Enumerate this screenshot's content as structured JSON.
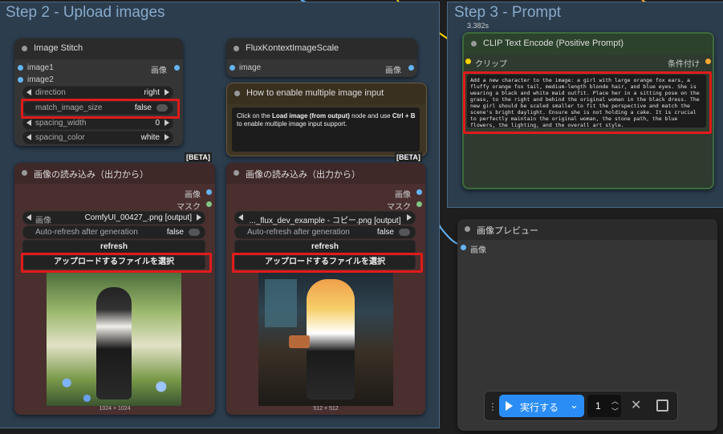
{
  "groups": {
    "step2": "Step 2 - Upload images",
    "step3": "Step 3 - Prompt"
  },
  "image_stitch": {
    "title": "Image Stitch",
    "inputs": [
      "image1",
      "image2"
    ],
    "output": "画像",
    "widgets": [
      {
        "label": "direction",
        "value": "right"
      },
      {
        "label": "match_image_size",
        "value": "false"
      },
      {
        "label": "spacing_width",
        "value": "0"
      },
      {
        "label": "spacing_color",
        "value": "white"
      }
    ]
  },
  "flux_scale": {
    "title": "FluxKontextImageScale",
    "input": "image",
    "output": "画像"
  },
  "how_to": {
    "title": "How to enable multiple image input",
    "text_pre": "Click on the ",
    "text_bold1": "Load image (from output)",
    "text_mid": " node and use ",
    "text_bold2": "Ctrl + B",
    "text_post": " to enable multiple image input support."
  },
  "beta_label": "[BETA]",
  "load_left": {
    "title": "画像の読み込み（出力から）",
    "output1": "画像",
    "output2": "マスク",
    "image_label": "画像",
    "image_value": "ComfyUI_00427_.png [output]",
    "auto_label": "Auto-refresh after generation",
    "auto_value": "false",
    "refresh": "refresh",
    "upload": "アップロードするファイルを選択",
    "dims": "1024 × 1024"
  },
  "load_right": {
    "title": "画像の読み込み（出力から）",
    "output1": "画像",
    "output2": "マスク",
    "image_label": "画像",
    "image_value": "..._flux_dev_example - コピー.png [output]",
    "auto_label": "Auto-refresh after generation",
    "auto_value": "false",
    "refresh": "refresh",
    "upload": "アップロードするファイルを選択",
    "dims": "512 × 512"
  },
  "clip": {
    "timing": "3.382s",
    "title": "CLIP Text Encode (Positive Prompt)",
    "input": "クリップ",
    "output": "条件付け",
    "prompt": "Add a new character to the image: a girl with large orange fox ears, a fluffy orange fox tail, medium-length blonde hair, and blue eyes. She is wearing a black and white maid outfit. Place her in a sitting pose on the grass, to the right and behind the original woman in the black dress. The new girl should be scaled smaller to fit the perspective and match the scene's bright daylight. Ensure she is not holding a cake. It is crucial to perfectly maintain the original woman, the stone path, the blue flowers, the lighting, and the overall art style."
  },
  "preview": {
    "title": "画像プレビュー",
    "input": "画像"
  },
  "run_bar": {
    "run_label": "実行する",
    "count": "1"
  },
  "colors": {
    "image_port": "#64b5f6",
    "mask_port": "#81c784",
    "clip_port": "#ffd500",
    "cond_port": "#ffa931",
    "highlight": "#e01b1b",
    "run_button": "#2a8df5"
  }
}
